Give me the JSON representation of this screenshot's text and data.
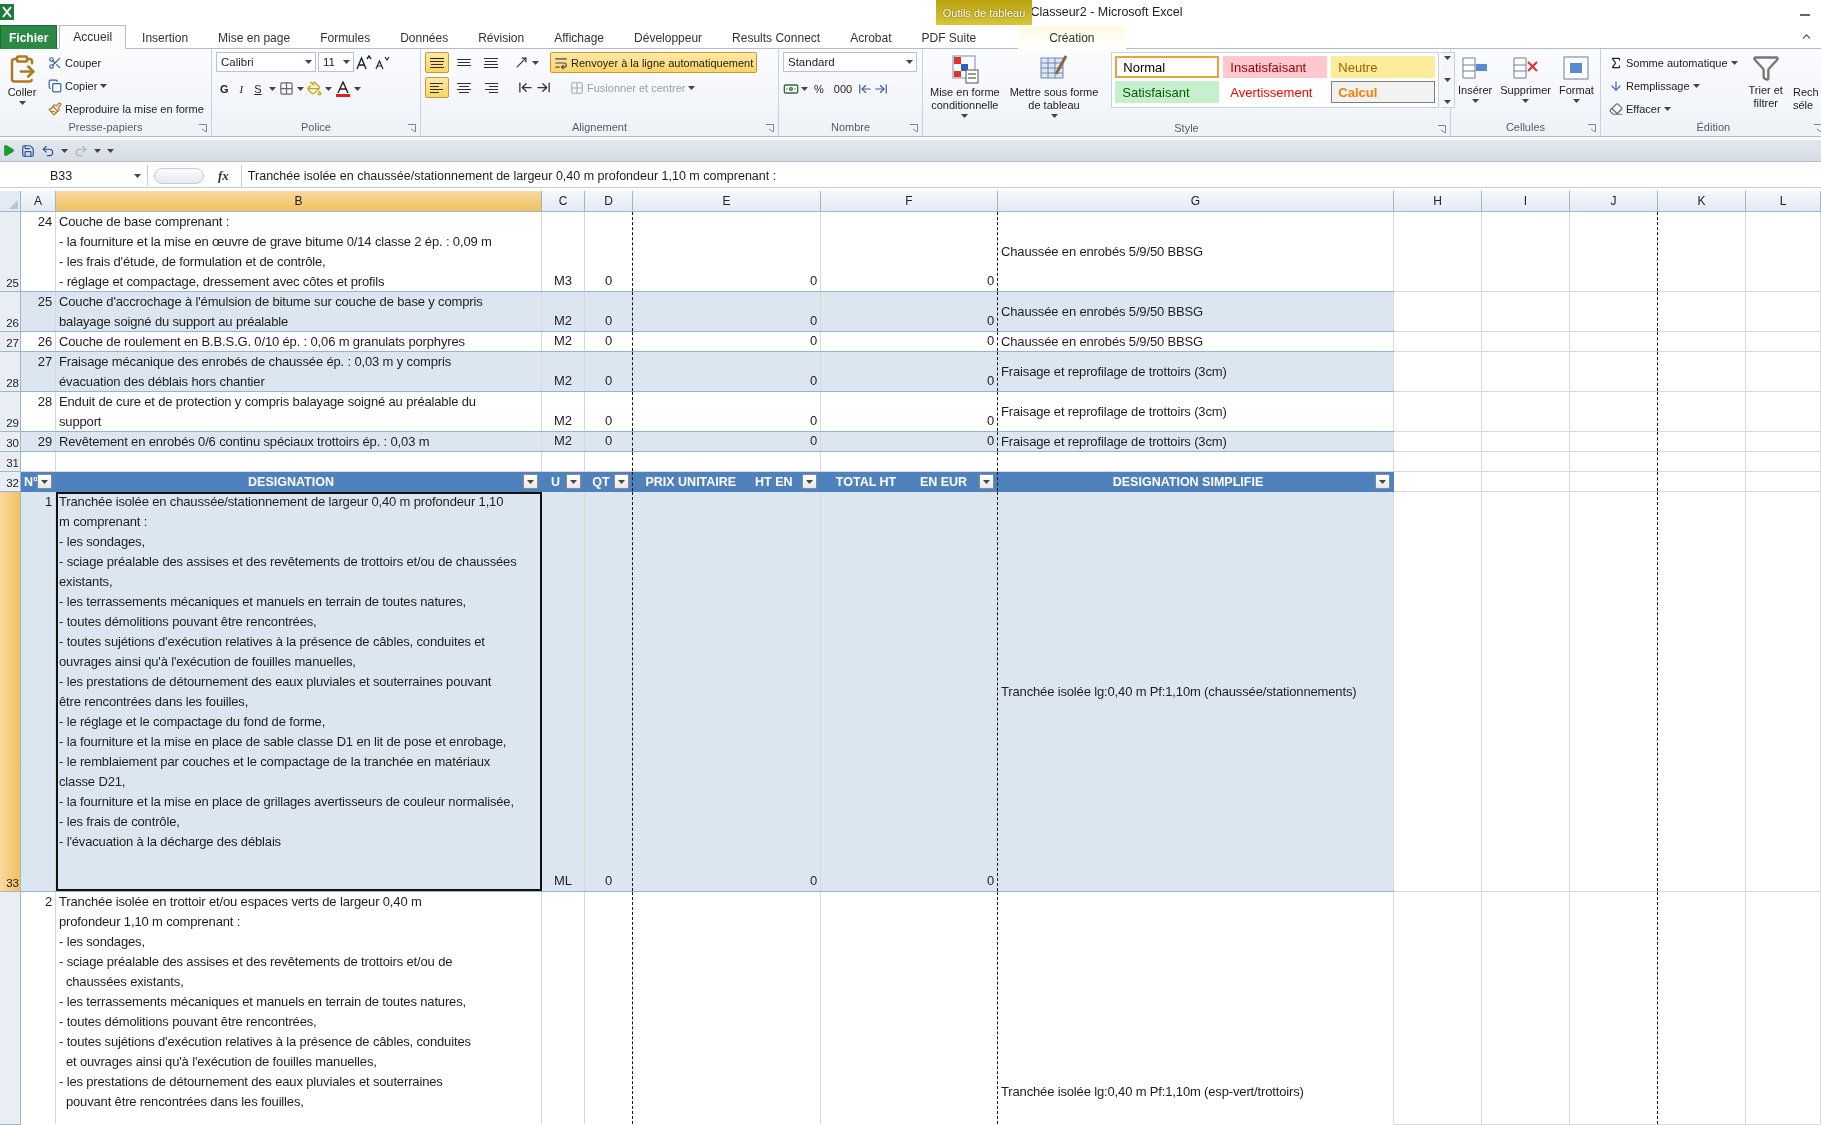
{
  "window": {
    "title": "Classeur2  -  Microsoft Excel",
    "context_label": "Outils de tableau"
  },
  "tabs": [
    {
      "label": "Fichier",
      "kind": "file",
      "selected": false
    },
    {
      "label": "Accueil",
      "kind": "tab",
      "selected": true
    },
    {
      "label": "Insertion",
      "kind": "tab",
      "selected": false
    },
    {
      "label": "Mise en page",
      "kind": "tab",
      "selected": false
    },
    {
      "label": "Formules",
      "kind": "tab",
      "selected": false
    },
    {
      "label": "Données",
      "kind": "tab",
      "selected": false
    },
    {
      "label": "Révision",
      "kind": "tab",
      "selected": false
    },
    {
      "label": "Affichage",
      "kind": "tab",
      "selected": false
    },
    {
      "label": "Développeur",
      "kind": "tab",
      "selected": false
    },
    {
      "label": "Results Connect",
      "kind": "tab",
      "selected": false
    },
    {
      "label": "Acrobat",
      "kind": "tab",
      "selected": false
    },
    {
      "label": "PDF Suite",
      "kind": "tab",
      "selected": false
    },
    {
      "label": "Création",
      "kind": "contextual",
      "selected": false
    }
  ],
  "ribbon": {
    "clipboard": {
      "label": "Presse-papiers",
      "paste": "Coller",
      "cut": "Couper",
      "copy": "Copier",
      "painter": "Reproduire la mise en forme"
    },
    "font": {
      "label": "Police",
      "name": "Calibri",
      "size": "11",
      "bold": "G",
      "italic": "I",
      "underline": "S"
    },
    "alignment": {
      "label": "Alignement",
      "top_on": true,
      "left_on": true,
      "wrap": "Renvoyer à la ligne automatiquement",
      "wrap_on": true,
      "merge": "Fusionner et centrer",
      "merge_disabled": true
    },
    "number": {
      "label": "Nombre",
      "format": "Standard",
      "percent": "%",
      "thousands": "000"
    },
    "styles": {
      "label": "Style",
      "conditional": "Mise en forme\nconditionnelle",
      "table": "Mettre sous forme\nde tableau",
      "gallery": [
        {
          "text": "Normal",
          "kind": "normal",
          "selected": true
        },
        {
          "text": "Insatisfaisant",
          "kind": "bad",
          "selected": false
        },
        {
          "text": "Neutre",
          "kind": "neutral",
          "selected": false
        },
        {
          "text": "Satisfaisant",
          "kind": "good",
          "selected": false
        },
        {
          "text": "Avertissement",
          "kind": "warning",
          "selected": false
        },
        {
          "text": "Calcul",
          "kind": "calc",
          "selected": false
        }
      ]
    },
    "cells": {
      "label": "Cellules",
      "insert": "Insérer",
      "delete": "Supprimer",
      "format": "Format"
    },
    "editing": {
      "label": "Édition",
      "autosum": "Somme automatique",
      "fill": "Remplissage",
      "clear": "Effacer",
      "sort": "Trier et\nfiltrer",
      "find": "Rech\nséle"
    }
  },
  "formula_bar": {
    "name_box": "B33",
    "fx": "fx",
    "formula": "Tranchée isolée en chaussée/stationnement de largeur 0,40 m profondeur 1,10 m comprenant :"
  },
  "columns": [
    {
      "letter": "A",
      "selected": false
    },
    {
      "letter": "B",
      "selected": true
    },
    {
      "letter": "C",
      "selected": false
    },
    {
      "letter": "D",
      "selected": false
    },
    {
      "letter": "E",
      "selected": false
    },
    {
      "letter": "F",
      "selected": false
    },
    {
      "letter": "G",
      "selected": false
    },
    {
      "letter": "H",
      "selected": false
    },
    {
      "letter": "I",
      "selected": false
    },
    {
      "letter": "J",
      "selected": false
    },
    {
      "letter": "K",
      "selected": false
    },
    {
      "letter": "L",
      "selected": false
    }
  ],
  "rows": [
    {
      "kind": "item",
      "row": "25",
      "num": "24",
      "text": "Couche de base comprenant :\n- la fourniture et la mise en œuvre de grave bitume 0/14 classe 2 ép. : 0,09 m\n- les frais d'étude, de formulation et de contrôle,\n- réglage et compactage, dressement avec côtes et profils",
      "unit": "M3",
      "qty": "0",
      "price": "0",
      "total": "0",
      "simple": "Chaussée en enrobés 5/9/50 BBSG",
      "banded": false,
      "selected": false
    },
    {
      "kind": "item",
      "row": "26",
      "num": "25",
      "text": "Couche d'accrochage à l'émulsion de bitume sur couche de base y compris\nbalayage soigné du support au préalable",
      "unit": "M2",
      "qty": "0",
      "price": "0",
      "total": "0",
      "simple": "Chaussée en enrobés 5/9/50 BBSG",
      "banded": true,
      "selected": false
    },
    {
      "kind": "item",
      "row": "27",
      "num": "26",
      "text": "Couche de roulement en B.B.S.G. 0/10 ép. : 0,06 m granulats porphyres",
      "unit": "M2",
      "qty": "0",
      "price": "0",
      "total": "0",
      "simple": "Chaussée en enrobés 5/9/50 BBSG",
      "banded": false,
      "selected": false
    },
    {
      "kind": "item",
      "row": "28",
      "num": "27",
      "text": "Fraisage mécanique des enrobés de chaussée ép. : 0,03 m y compris\névacuation des déblais hors chantier",
      "unit": "M2",
      "qty": "0",
      "price": "0",
      "total": "0",
      "simple": "Fraisage et reprofilage de trottoirs (3cm)",
      "banded": true,
      "selected": false
    },
    {
      "kind": "item",
      "row": "29",
      "num": "28",
      "text": "Enduit de cure et de protection y compris balayage soigné au préalable du\nsupport",
      "unit": "M2",
      "qty": "0",
      "price": "0",
      "total": "0",
      "simple": "Fraisage et reprofilage de trottoirs (3cm)",
      "banded": false,
      "selected": false
    },
    {
      "kind": "item",
      "row": "30",
      "num": "29",
      "text": "Revêtement en enrobés 0/6 continu spéciaux trottoirs ép. : 0,03 m",
      "unit": "M2",
      "qty": "0",
      "price": "0",
      "total": "0",
      "simple": "Fraisage et reprofilage de trottoirs (3cm)",
      "banded": true,
      "selected": false
    },
    {
      "kind": "blank",
      "row": "31"
    },
    {
      "kind": "header",
      "row": "32",
      "cells": [
        {
          "texts": [
            "N°"
          ],
          "filter": true
        },
        {
          "texts": [
            "DESIGNATION"
          ],
          "filter": true
        },
        {
          "texts": [
            "U"
          ],
          "filter": true
        },
        {
          "texts": [
            "QT"
          ],
          "filter": true
        },
        {
          "texts": [
            "PRIX UNITAIRE",
            "HT EN"
          ],
          "filter": true
        },
        {
          "texts": [
            "TOTAL HT",
            "EN EUR"
          ],
          "filter": true
        },
        {
          "texts": [
            "DESIGNATION SIMPLIFIE"
          ],
          "filter": true
        }
      ]
    },
    {
      "kind": "tall",
      "row": "33",
      "num": "1",
      "text": "Tranchée isolée en chaussée/stationnement de largeur 0,40 m profondeur 1,10\nm comprenant :\n- les sondages,\n- sciage préalable des assises et des revêtements de trottoirs et/ou de chaussées\nexistants,\n- les terrassements mécaniques et manuels en terrain de toutes natures,\n- toutes démolitions pouvant être rencontrées,\n- toutes sujétions d'exécution relatives à la présence de câbles, conduites et\nouvrages ainsi qu'à l'exécution de fouilles manuelles,\n- les prestations de détournement des eaux pluviales et souterraines pouvant\nêtre rencontrées dans les fouilles,\n- le réglage et le compactage du fond de forme,\n- la fourniture et la mise en place de sable classe D1 en lit de pose et enrobage,\n- le remblaiement par couches et le compactage de la tranchée en matériaux\nclasse D21,\n- la fourniture et la mise en place de grillages avertisseurs de couleur normalisée,\n- les frais de contrôle,\n- l'évacuation à la décharge des déblais",
      "unit": "ML",
      "qty": "0",
      "price": "0",
      "total": "0",
      "simple": "Tranchée isolée lg:0,40 m Pf:1,10m (chaussée/stationnements)",
      "banded": true,
      "selected": true
    },
    {
      "kind": "last",
      "num": "2",
      "text": "Tranchée isolée en trottoir et/ou espaces verts de largeur 0,40 m\nprofondeur 1,10 m comprenant :\n- les sondages,\n- sciage préalable des assises et des revêtements de trottoirs et/ou de\n  chaussées existants,\n- les terrassements mécaniques et manuels en terrain de toutes natures,\n- toutes démolitions pouvant être rencontrées,\n- toutes sujétions d'exécution relatives à la présence de câbles, conduites\n  et ouvrages ainsi qu'à l'exécution de fouilles manuelles,\n- les prestations de détournement des eaux pluviales et souterraines\n  pouvant être rencontrées dans les fouilles,",
      "simple": "Tranchée isolée lg:0,40 m Pf:1,10m (esp-vert/trottoirs)",
      "banded": false,
      "selected": false
    }
  ]
}
